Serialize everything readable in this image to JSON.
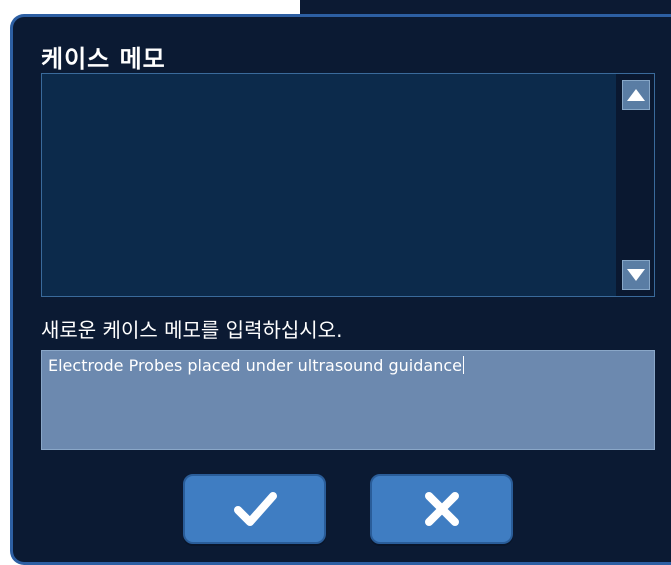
{
  "dialog": {
    "title": "케이스 메모",
    "prompt": "새로운 케이스 메모를 입력하십시오.",
    "input_value": "Electrode Probes placed under ultrasound guidance",
    "scroll_up_icon": "arrow-up-icon",
    "scroll_down_icon": "arrow-down-icon",
    "confirm_icon": "checkmark-icon",
    "cancel_icon": "x-icon"
  },
  "colors": {
    "dialog_bg": "#0b1a33",
    "list_bg": "#0c2a4b",
    "input_bg": "#6c89af",
    "button_bg": "#3f7dc2"
  }
}
